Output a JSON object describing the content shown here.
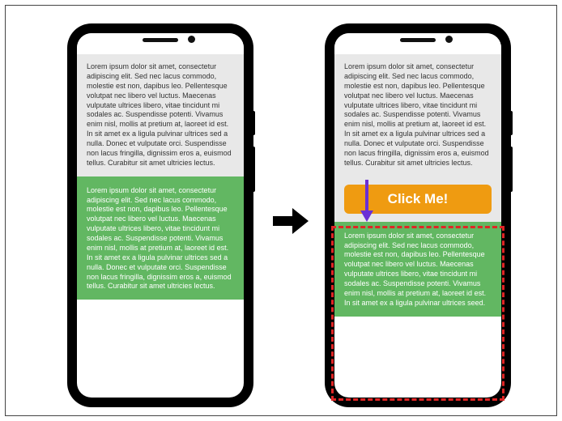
{
  "lorem_gray": "Lorem ipsum dolor sit amet, consectetur adipiscing elit. Sed nec lacus commodo, molestie est non, dapibus leo. Pellentesque volutpat nec libero vel luctus. Maecenas vulputate ultrices libero, vitae tincidunt mi sodales ac. Suspendisse potenti. Vivamus enim nisl, mollis at pretium at, laoreet id est. In sit amet ex a ligula pulvinar ultrices sed a nulla. Donec et vulputate orci. Suspendisse non lacus fringilla, dignissim eros a, euismod tellus. Curabitur sit amet ultricies lectus.",
  "lorem_green_full": "Lorem ipsum dolor sit amet, consectetur adipiscing elit. Sed nec lacus commodo, molestie est non, dapibus leo. Pellentesque volutpat nec libero vel luctus. Maecenas vulputate ultrices libero, vitae tincidunt mi sodales ac. Suspendisse potenti. Vivamus enim nisl, mollis at pretium at, laoreet id est. In sit amet ex a ligula pulvinar ultrices sed a nulla. Donec et vulputate orci. Suspendisse non lacus fringilla, dignissim eros a, euismod tellus. Curabitur sit amet ultricies lectus.",
  "lorem_green_short": "Lorem ipsum dolor sit amet, consectetur adipiscing elit. Sed nec lacus commodo, molestie est non, dapibus leo. Pellentesque volutpat nec libero vel luctus. Maecenas vulputate ultrices libero, vitae tincidunt mi sodales ac. Suspendisse potenti. Vivamus enim nisl, mollis at pretium at, laoreet id est. In sit amet ex a ligula pulvinar ultrices seed.",
  "button_label": "Click Me!"
}
